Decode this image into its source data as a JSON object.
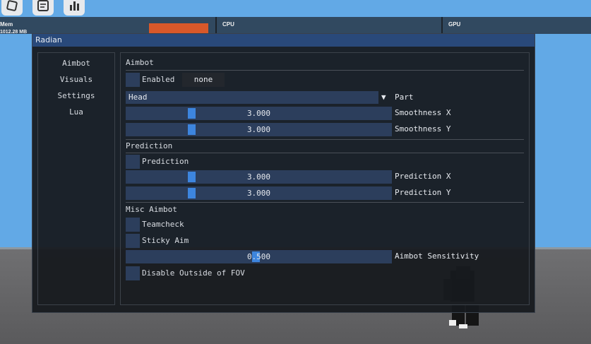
{
  "stats": {
    "mem_label": "Mem",
    "mem_value": "1012.28 MB",
    "cpu_label": "CPU",
    "gpu_label": "GPU"
  },
  "window": {
    "title": "Radian",
    "tabs": [
      "Aimbot",
      "Visuals",
      "Settings",
      "Lua"
    ]
  },
  "aimbot": {
    "title": "Aimbot",
    "enabled_label": "Enabled",
    "enabled_checked": false,
    "keybind": "none",
    "part_value": "Head",
    "part_label": "Part",
    "smooth_x_value": "3.000",
    "smooth_x_label": "Smoothness X",
    "smooth_y_value": "3.000",
    "smooth_y_label": "Smoothness Y"
  },
  "prediction": {
    "title": "Prediction",
    "toggle_label": "Prediction",
    "x_value": "3.000",
    "x_label": "Prediction X",
    "y_value": "3.000",
    "y_label": "Prediction Y"
  },
  "misc": {
    "title": "Misc Aimbot",
    "teamcheck_label": "Teamcheck",
    "sticky_label": "Sticky Aim",
    "sensitivity_value": "0.500",
    "sensitivity_label": "Aimbot Sensitivity",
    "fov_label": "Disable Outside of FOV"
  },
  "slider_levels": {
    "smooth_x": 0.24,
    "smooth_y": 0.24,
    "pred_x": 0.24,
    "pred_y": 0.24,
    "sensitivity": 0.49
  },
  "colors": {
    "accent": "#3d85de",
    "frame": "#2c3e5c",
    "titlebar": "#29497a",
    "mem_bar": "#d8582a"
  }
}
